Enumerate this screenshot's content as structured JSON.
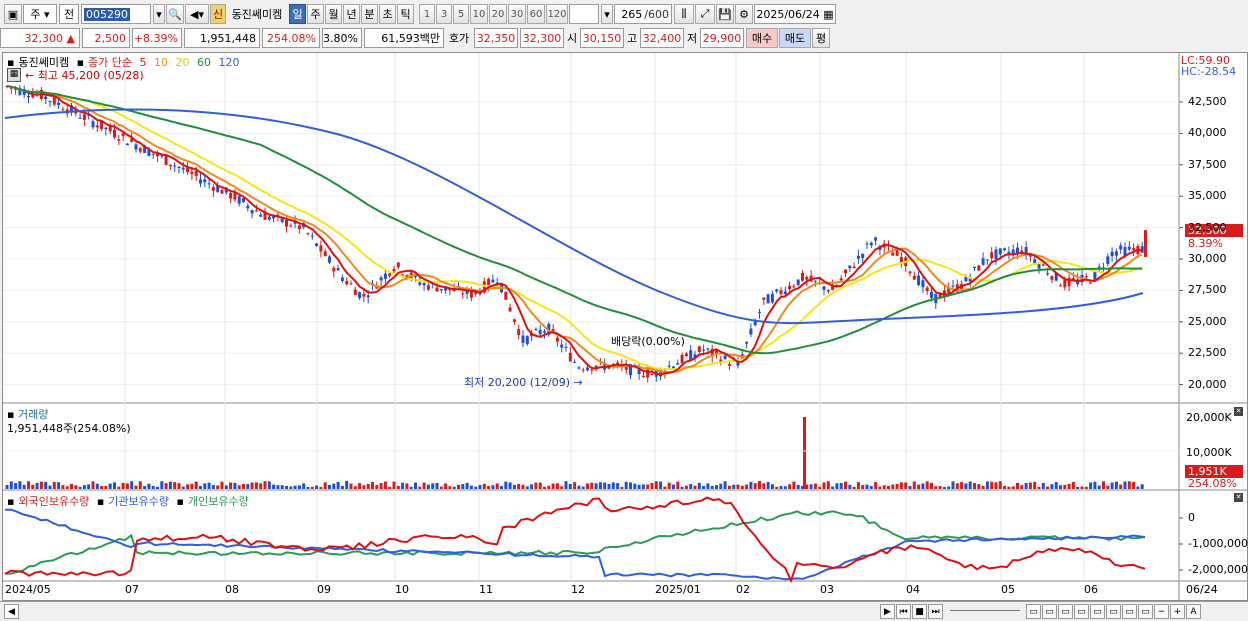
{
  "toolbar": {
    "period_label": "주",
    "prev_label": "전",
    "stock_code": "005290",
    "stock_name": "동진쎄미켐",
    "new_label": "신",
    "periods": [
      "일",
      "주",
      "월",
      "년",
      "분",
      "초",
      "틱"
    ],
    "active_period": "일",
    "minutes": [
      "1",
      "3",
      "5",
      "10",
      "20",
      "30",
      "60",
      "120"
    ],
    "count": "265",
    "count_total": "/600",
    "date": "2025/06/24"
  },
  "quote": {
    "price": "32,300",
    "arrow": "▲",
    "change": "2,500",
    "change_pct": "+8.39%",
    "volume": "1,951,448",
    "volume_ratio": "254.08%",
    "turnover": "3.80%",
    "amount": "61,593백만",
    "ask_label": "호가",
    "ask1": "32,350",
    "ask2": "32,300",
    "open_label": "시",
    "open": "30,150",
    "high_label": "고",
    "high": "32,400",
    "low_label": "저",
    "low": "29,900",
    "buy_label": "매수",
    "sell_label": "매도",
    "eval_label": "평"
  },
  "price_panel": {
    "name": "동진쎄미켐",
    "ma_label": "종가 단순",
    "ma_periods": [
      "5",
      "10",
      "20",
      "60",
      "120"
    ],
    "high_note": "최고 45,200 (05/28)",
    "low_note": "최저 20,200 (12/09)",
    "dividend_note": "배당락(0.00%)",
    "lc": "LC:59.90",
    "hc": "HC:-28.54",
    "last_price": "32,300",
    "last_pct": "8.39%",
    "y_ticks": [
      "42,500",
      "40,000",
      "37,500",
      "35,000",
      "32,500",
      "30,000",
      "27,500",
      "25,000",
      "22,500",
      "20,000"
    ]
  },
  "volume_panel": {
    "title": "거래량",
    "value_note": "1,951,448주(254.08%)",
    "y_ticks": [
      "20,000K",
      "10,000K"
    ],
    "last_vol": "1,951K",
    "last_pct": "254.08%"
  },
  "holding_panel": {
    "series_labels": [
      "외국인보유수량",
      "기관보유수량",
      "개인보유수량"
    ],
    "y_ticks": [
      "0",
      "-1,000,000",
      "-2,000,000"
    ]
  },
  "x_labels": [
    "2024/05",
    "07",
    "08",
    "09",
    "10",
    "11",
    "12",
    "2025/01",
    "02",
    "03",
    "04",
    "05",
    "06",
    "06/24"
  ],
  "colors": {
    "up": "#d81c1c",
    "down": "#1f4fd8",
    "ma5": "#e01010",
    "ma10": "#f08a1a",
    "ma20": "#f5e61a",
    "ma60": "#1f8f3a",
    "ma120": "#2f5fe0",
    "foreign": "#e01010",
    "inst": "#2f5fe0",
    "retail": "#2e9a5a"
  }
}
